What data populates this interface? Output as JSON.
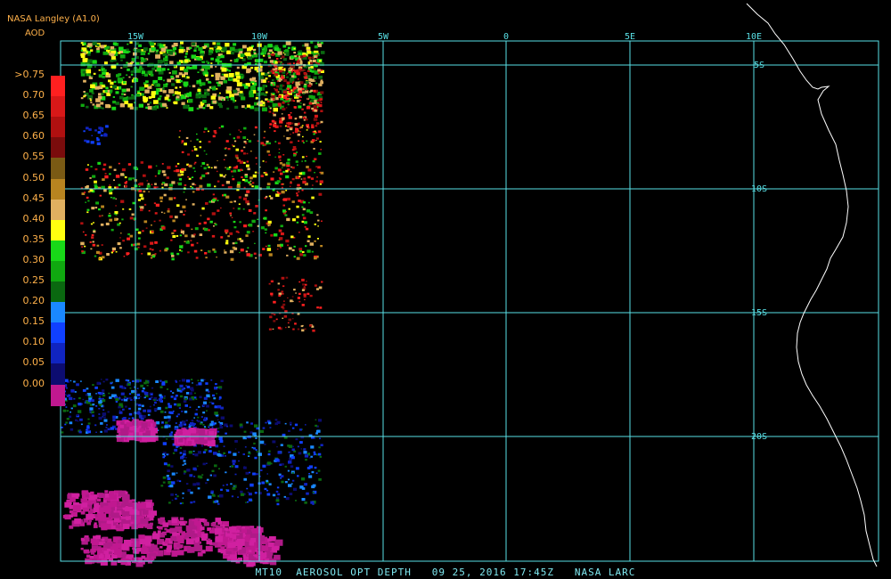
{
  "header": {
    "source": "NASA Langley (A1.0)",
    "product": "AOD"
  },
  "legend": {
    "labels": [
      ">0.75",
      "0.70",
      "0.65",
      "0.60",
      "0.55",
      "0.50",
      "0.45",
      "0.40",
      "0.35",
      "0.30",
      "0.25",
      "0.20",
      "0.15",
      "0.10",
      "0.05",
      "0.00"
    ],
    "colors": [
      "#ff2020",
      "#d81818",
      "#b01010",
      "#7a0c0c",
      "#7a5a14",
      "#b88420",
      "#e0b060",
      "#ffff10",
      "#18d818",
      "#10a810",
      "#0a6810",
      "#1a88ff",
      "#1040ff",
      "#1024c0",
      "#0c0c70",
      "#c01890"
    ]
  },
  "grid": {
    "longitudes": [
      "15W",
      "10W",
      "5W",
      "0",
      "5E",
      "10E"
    ],
    "latitudes": [
      "5S",
      "10S",
      "15S",
      "20S"
    ],
    "line_color": "#59e0e6"
  },
  "caption": "MT10  AEROSOL OPT DEPTH   09 25, 2016 17:45Z   NASA LARC"
}
